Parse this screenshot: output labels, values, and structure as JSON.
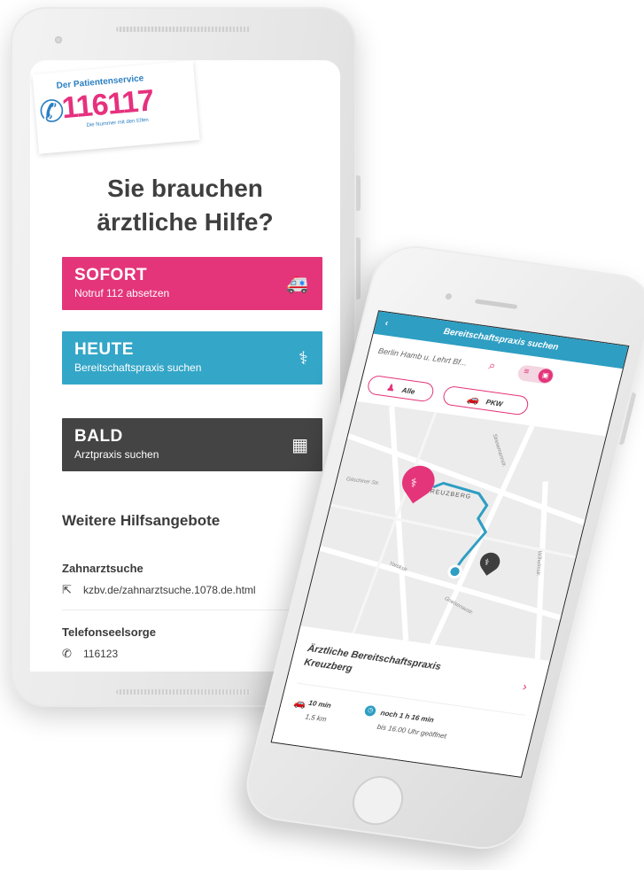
{
  "android": {
    "logo": {
      "service_text": "Der Patientenservice",
      "number": "116117",
      "tagline": "Die Nummer mit den Elfen"
    },
    "heading_line1": "Sie brauchen",
    "heading_line2": "ärztliche Hilfe?",
    "options": [
      {
        "title": "SOFORT",
        "subtitle": "Notruf 112 absetzen",
        "color": "#e4357a",
        "icon": "ambulance-icon"
      },
      {
        "title": "HEUTE",
        "subtitle": "Bereitschaftspraxis suchen",
        "color": "#34a6c8",
        "icon": "doctor-icon"
      },
      {
        "title": "BALD",
        "subtitle": "Arztpraxis suchen",
        "color": "#444444",
        "icon": "calendar-icon"
      }
    ],
    "more_title": "Weitere Hilfsangebote",
    "more_items": [
      {
        "title": "Zahnarztsuche",
        "value": "kzbv.de/zahnarztsuche.1078.de.html",
        "icon": "external-link-icon"
      },
      {
        "title": "Telefonseelsorge",
        "value": "116123",
        "icon": "phone-icon"
      }
    ]
  },
  "iphone": {
    "nav_title": "Bereitschaftspraxis suchen",
    "search_text": "Berlin Hamb u. Lehrt Bf...",
    "filters": [
      {
        "label": "Alle",
        "icon": "person-icon"
      },
      {
        "label": "PKW",
        "icon": "car-icon"
      }
    ],
    "map": {
      "district": "KREUZBERG",
      "streets": [
        "Stresemannstr.",
        "Wilhelmstr.",
        "Yorckstr.",
        "Gitschiner Str.",
        "Gneisenaustr."
      ]
    },
    "result": {
      "name": "Ärztliche Bereitschaftspraxis Kreuzberg",
      "drive_time": "10 min",
      "distance": "1,5 km",
      "open_remaining": "noch 1 h 16 min",
      "open_until": "bis 16.00 Uhr geöffnet"
    }
  }
}
